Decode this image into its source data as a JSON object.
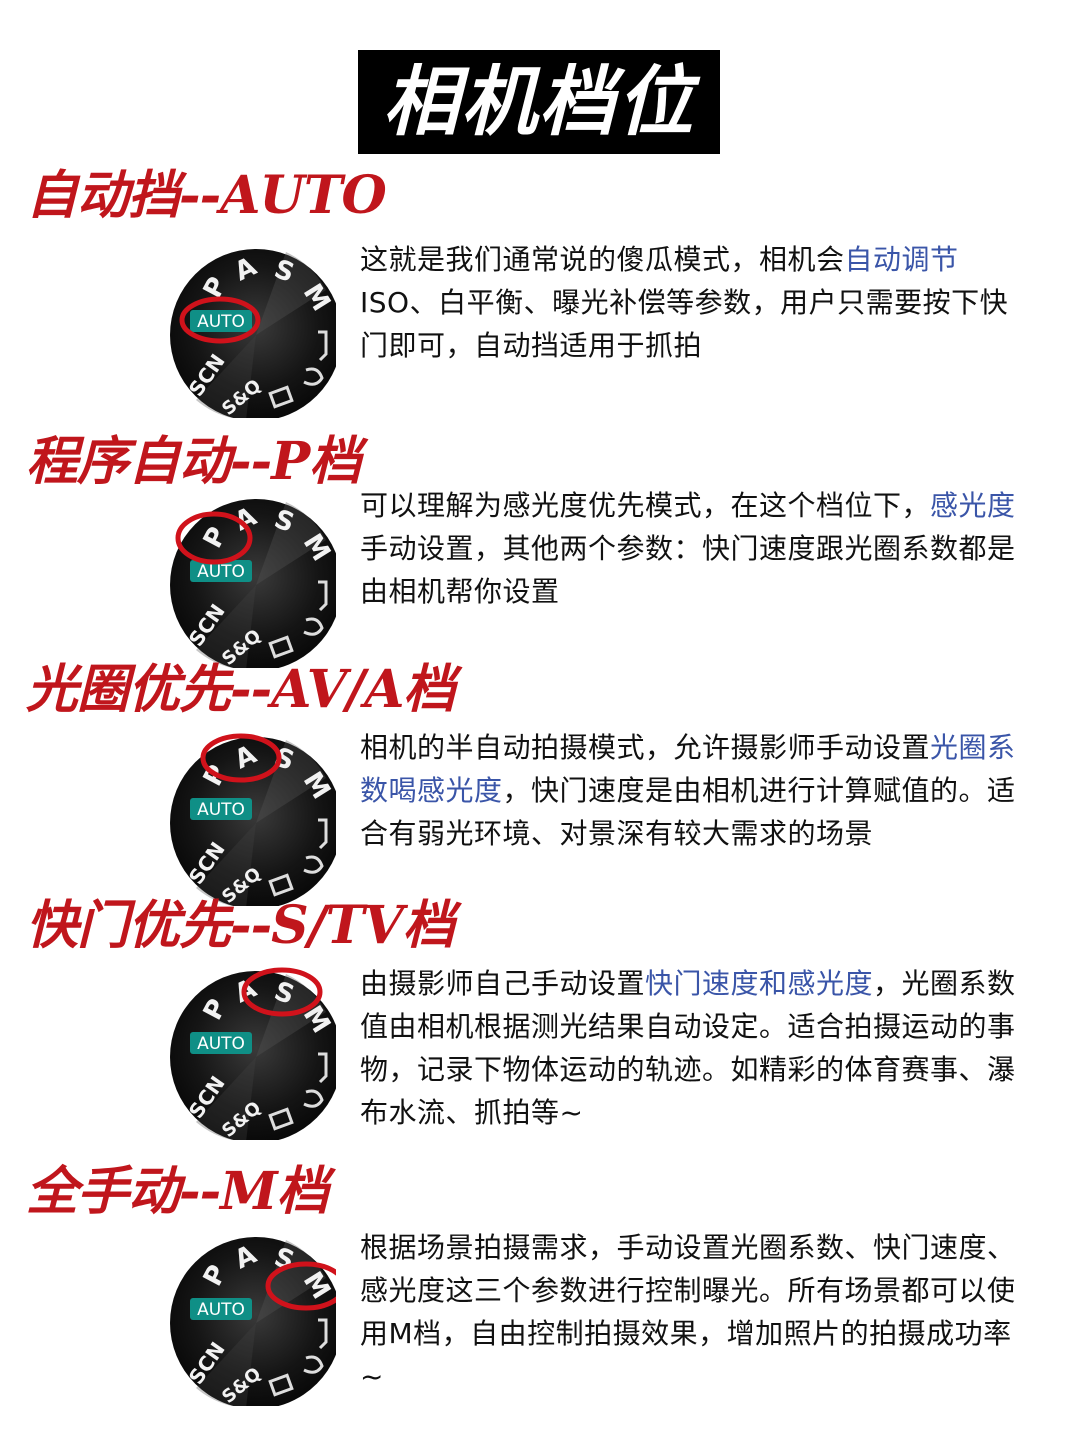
{
  "title": "相机档位",
  "dial_labels": {
    "p": "P",
    "a": "A",
    "s": "S",
    "m": "M",
    "auto": "AUTO",
    "scn": "SCN",
    "sq": "S&Q"
  },
  "colors": {
    "heading": "#c0161c",
    "highlight": "#3a55a8",
    "circle": "#d0121b"
  },
  "sections": [
    {
      "heading": "自动挡--AUTO",
      "circled": "auto",
      "desc_pre": "这就是我们通常说的傻瓜模式，相机会",
      "desc_hl": "自动调节",
      "desc_post": "ISO、白平衡、曝光补偿等参数，用户只需要按下快门即可，自动挡适用于抓拍"
    },
    {
      "heading": "程序自动--P档",
      "circled": "p",
      "desc_pre": "可以理解为感光度优先模式，在这个档位下，",
      "desc_hl": "感光度",
      "desc_post": "手动设置，其他两个参数：快门速度跟光圈系数都是由相机帮你设置"
    },
    {
      "heading": "光圈优先--AV/A档",
      "circled": "a",
      "desc_pre": "相机的半自动拍摄模式，允许摄影师手动设置",
      "desc_hl": "光圈系数喝感光度",
      "desc_post": "，快门速度是由相机进行计算赋值的。适合有弱光环境、对景深有较大需求的场景"
    },
    {
      "heading": "快门优先--S/TV档",
      "circled": "s",
      "desc_pre": "由摄影师自己手动设置",
      "desc_hl": "快门速度和感光度",
      "desc_post": "，光圈系数值由相机根据测光结果自动设定。适合拍摄运动的事物，记录下物体运动的轨迹。如精彩的体育赛事、瀑布水流、抓拍等~"
    },
    {
      "heading": "全手动--M档",
      "circled": "m",
      "desc_pre": "根据场景拍摄需求，手动设置光圈系数、快门速度、感光度这三个参数进行控制曝光。所有场景都可以使用M档，自由控制拍摄效果，增加照片的拍摄成功率~",
      "desc_hl": "",
      "desc_post": ""
    }
  ]
}
